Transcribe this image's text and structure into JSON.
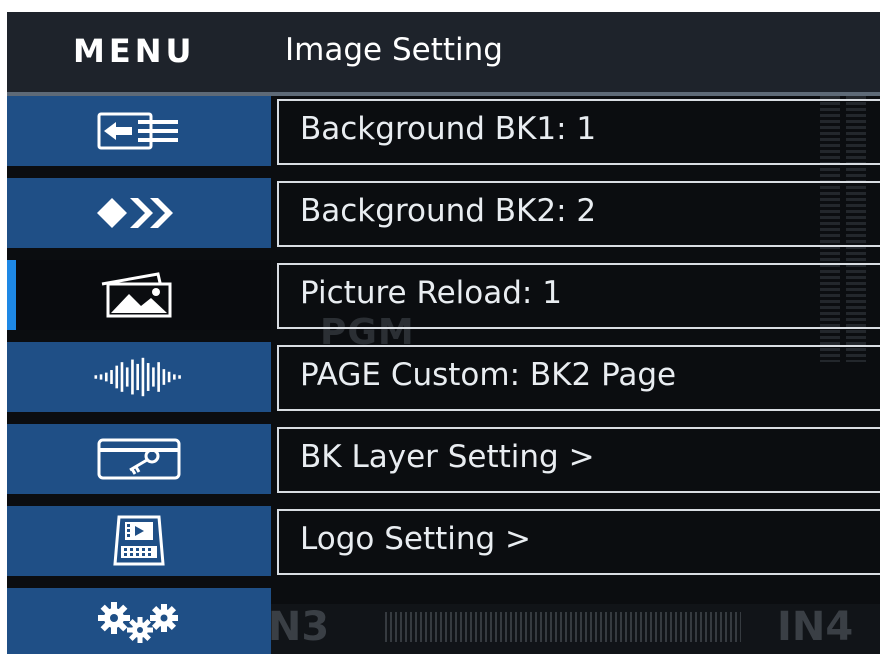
{
  "header": {
    "menu_label": "MENU",
    "page_title": "Image Setting"
  },
  "sidebar": {
    "items": [
      {
        "name": "input-switch",
        "icon": "input-switch-icon",
        "active": false
      },
      {
        "name": "transition",
        "icon": "transition-arrows-icon",
        "active": false
      },
      {
        "name": "picture",
        "icon": "picture-icon",
        "active": true
      },
      {
        "name": "audio",
        "icon": "audio-waveform-icon",
        "active": false
      },
      {
        "name": "key",
        "icon": "key-card-icon",
        "active": false
      },
      {
        "name": "media",
        "icon": "media-device-icon",
        "active": false
      },
      {
        "name": "settings",
        "icon": "gears-icon",
        "active": false
      }
    ]
  },
  "settings_list": [
    {
      "label": "Background BK1: 1"
    },
    {
      "label": "Background BK2: 2"
    },
    {
      "label": "Picture Reload: 1"
    },
    {
      "label": "PAGE Custom: BK2 Page"
    },
    {
      "label": "BK Layer Setting >"
    },
    {
      "label": "Logo Setting >"
    }
  ],
  "background": {
    "pgm_label": "PGM",
    "in3_label": "IN3",
    "in4_label": "IN4"
  },
  "colors": {
    "header_bg": "#1e232b",
    "sidebar_bg": "#1f4f86",
    "active_indicator": "#1e88e5",
    "screen_bg": "#0b0d10",
    "row_border": "#d9dde2"
  }
}
